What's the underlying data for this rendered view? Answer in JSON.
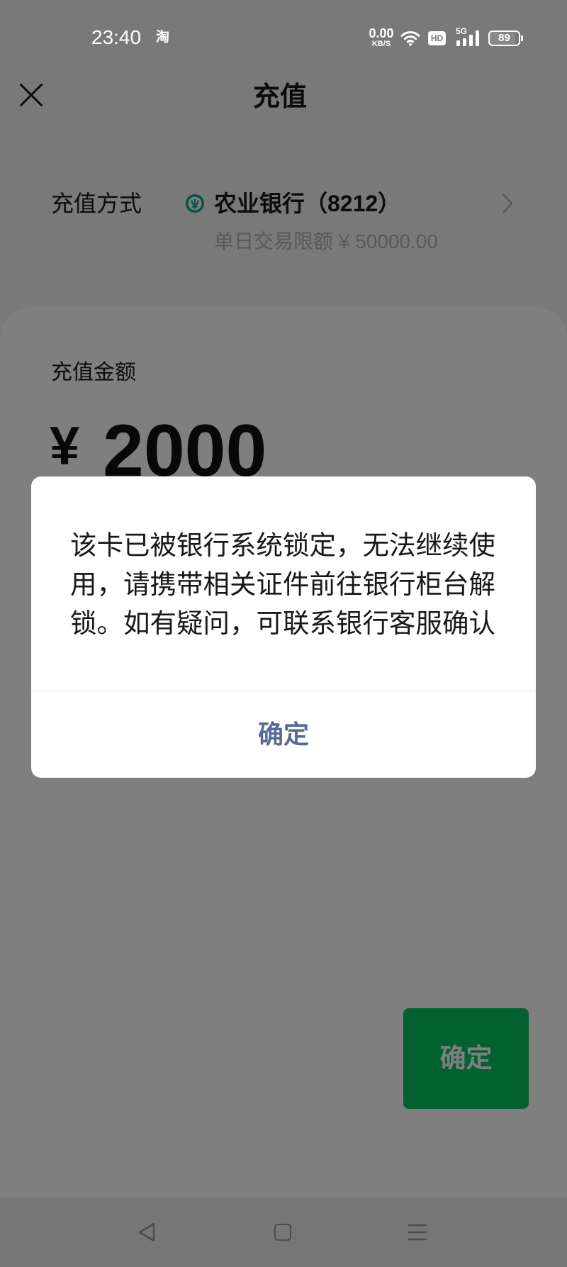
{
  "status_bar": {
    "time": "23:40",
    "notification_icon_label": "淘",
    "net_speed": {
      "value": "0.00",
      "unit": "KB/S"
    },
    "hd_label": "HD",
    "network_type": "5G",
    "battery_level": "89",
    "icons": [
      "taobao-notification-icon",
      "wifi-icon",
      "hd-icon",
      "signal-icon",
      "battery-icon"
    ]
  },
  "header": {
    "title": "充值",
    "close_icon": "close-icon"
  },
  "recharge_method": {
    "label": "充值方式",
    "bank_icon": "agricultural-bank-icon",
    "bank_name": "农业银行（8212）",
    "limit_text": "单日交易限额 ¥ 50000.00",
    "chevron_icon": "chevron-right-icon"
  },
  "amount": {
    "label": "充值金额",
    "currency": "¥",
    "value": "2000"
  },
  "confirm_button": {
    "label": "确定"
  },
  "dialog": {
    "message": "该卡已被银行系统锁定，无法继续使用，请携带相关证件前往银行柜台解锁。如有疑问，可联系银行客服确认",
    "confirm_label": "确定"
  },
  "nav_bar": {
    "icons": [
      "back-icon",
      "home-icon",
      "menu-icon"
    ]
  },
  "colors": {
    "primary_green": "#07c160",
    "dialog_link": "#576b95",
    "secondary_text": "#b2b2b2",
    "bank_brand": "#12a08a",
    "mask": "rgba(0,0,0,0.5)"
  }
}
